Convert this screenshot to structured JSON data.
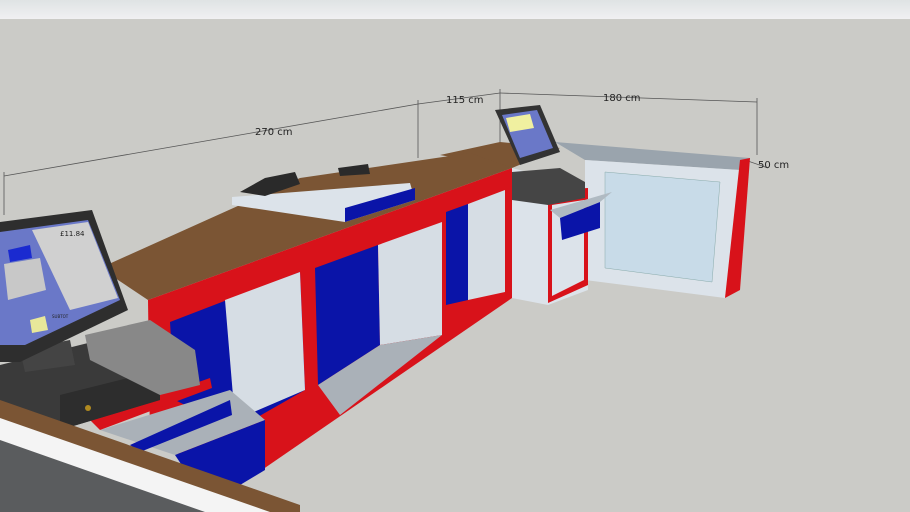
{
  "colors": {
    "sky": "#e6e8ea",
    "ground": "#cbcbc7",
    "wood": "#7b5534",
    "red": "#d8121a",
    "blue": "#0a14a8",
    "panel": "#d6dde4",
    "dark": "#3c3c3c"
  },
  "dimensions": {
    "length_main": "270 cm",
    "length_corner": "115 cm",
    "length_right": "180 cm",
    "depth": "50 cm"
  },
  "pos_screen": {
    "total": "£11.84",
    "subtotal_button": "SUBTOT"
  }
}
